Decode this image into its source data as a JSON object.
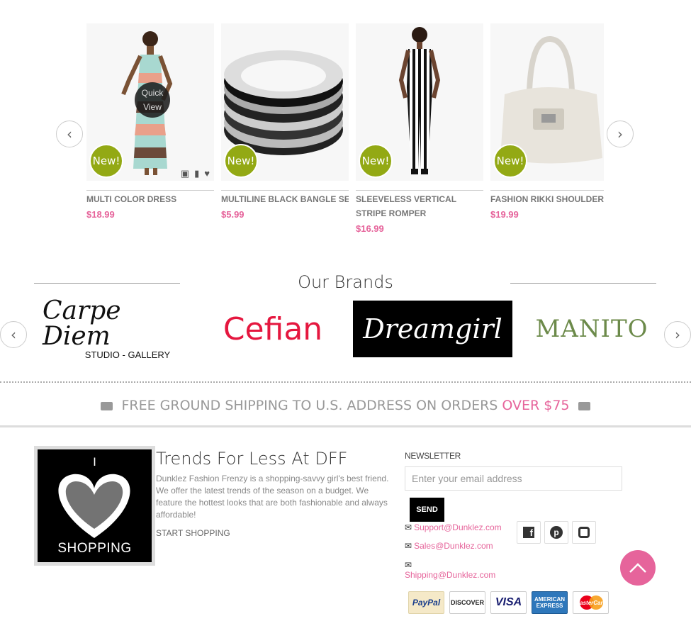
{
  "products": {
    "quick_view_label": "Quick View",
    "badge_label": "New!",
    "items": [
      {
        "name": "MULTI COLOR DRESS",
        "price": "$18.99"
      },
      {
        "name": "MULTILINE BLACK BANGLE SET",
        "price": "$5.99"
      },
      {
        "name": "SLEEVELESS VERTICAL STRIPE ROMPER",
        "price": "$16.99"
      },
      {
        "name": "FASHION RIKKI SHOULDER BAG",
        "price": "$19.99"
      }
    ]
  },
  "brands": {
    "title": "Our Brands",
    "items": [
      {
        "name": "Carpe Diem",
        "tagline": "STUDIO - GALLERY"
      },
      {
        "name": "Cefian"
      },
      {
        "name": "Dreamgirl"
      },
      {
        "name": "MANITO"
      }
    ]
  },
  "shipping": {
    "text": "FREE GROUND SHIPPING TO U.S. ADDRESS ON ORDERS",
    "highlight": "OVER $75"
  },
  "footer": {
    "logo": {
      "top": "I",
      "bottom": "SHOPPING"
    },
    "about_title": "Trends For Less At DFF",
    "about_text": "Dunklez Fashion Frenzy is a shopping-savvy girl's best friend. We offer the latest trends of the season on a budget. We feature the hottest looks that are both fashionable and always affordable!",
    "start_link": "START SHOPPING",
    "newsletter": {
      "title": "NEWSLETTER",
      "placeholder": "Enter your email address",
      "send_label": "SEND"
    },
    "emails": [
      "Support@Dunklez.com",
      "Sales@Dunklez.com",
      "Shipping@Dunklez.com"
    ],
    "payments": [
      "PayPal",
      "DISCOVER",
      "VISA",
      "AMERICAN EXPRESS",
      "MasterCard"
    ]
  },
  "colors": {
    "accent": "#e6649b",
    "badge": "#93a914"
  }
}
